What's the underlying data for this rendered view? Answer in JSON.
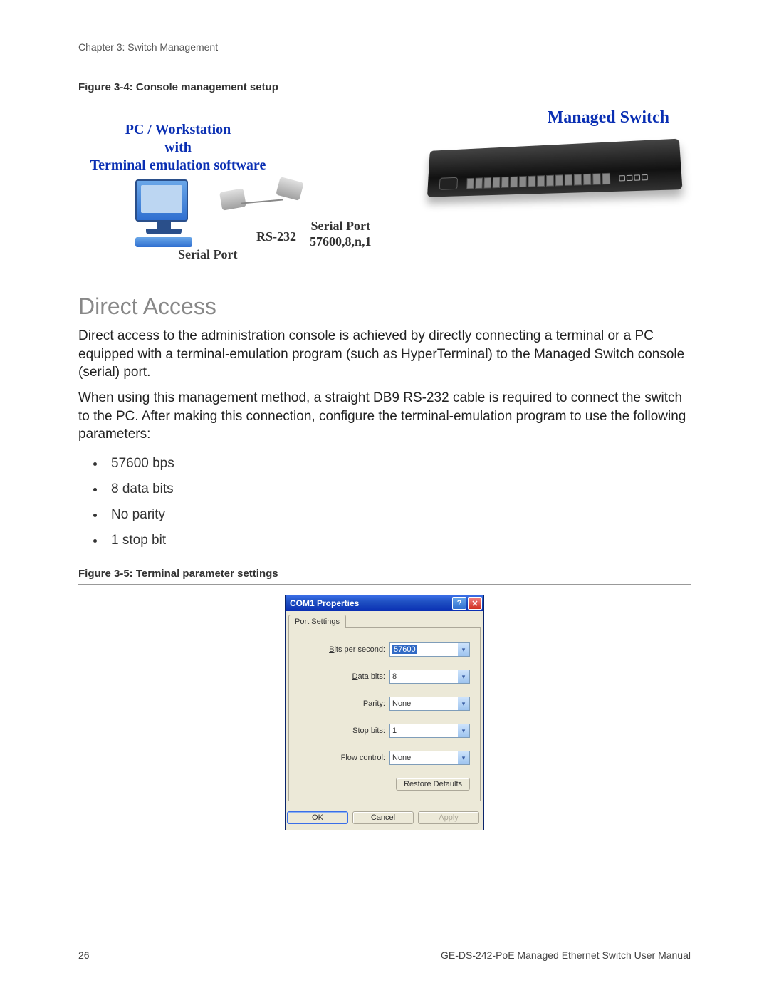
{
  "chapter": "Chapter 3: Switch Management",
  "figure1_caption": "Figure 3-4:  Console management setup",
  "diagram": {
    "pc_label": "PC / Workstation\nwith\nTerminal emulation software",
    "managed_label": "Managed Switch",
    "serial_left": "Serial Port",
    "rs232": "RS-232",
    "serial_right_l1": "Serial Port",
    "serial_right_l2": "57600,8,n,1"
  },
  "section_heading": "Direct Access",
  "para1": "Direct access to the administration console is achieved by directly connecting a terminal or a PC equipped with a terminal-emulation program (such as HyperTerminal) to the Managed Switch console (serial) port.",
  "para2": "When using this management method, a straight DB9 RS-232 cable is required to connect the switch to the PC. After making this connection, configure the terminal-emulation program to use the following parameters:",
  "params": [
    "57600 bps",
    "8 data bits",
    "No parity",
    "1 stop bit"
  ],
  "figure2_caption": "Figure 3-5:  Terminal parameter settings",
  "dialog": {
    "title": "COM1 Properties",
    "tab": "Port Settings",
    "fields": {
      "bps_label": "Bits per second:",
      "bps_value": "57600",
      "databits_label": "Data bits:",
      "databits_value": "8",
      "parity_label": "Parity:",
      "parity_value": "None",
      "stopbits_label": "Stop bits:",
      "stopbits_value": "1",
      "flow_label": "Flow control:",
      "flow_value": "None"
    },
    "restore": "Restore Defaults",
    "ok": "OK",
    "cancel": "Cancel",
    "apply": "Apply"
  },
  "footer": {
    "page": "26",
    "manual": "GE-DS-242-PoE Managed Ethernet Switch User Manual"
  }
}
